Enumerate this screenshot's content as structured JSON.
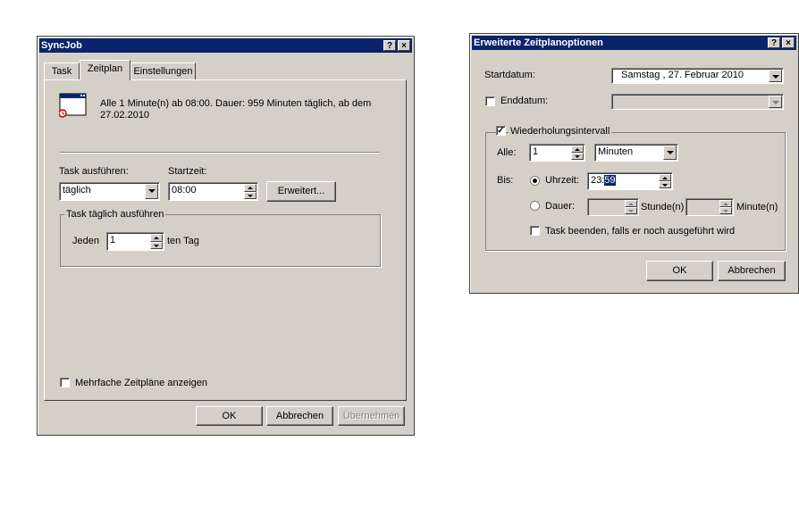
{
  "syncjob": {
    "title": "SyncJob",
    "help_label": "?",
    "close_label": "×",
    "tabs": [
      "Task",
      "Zeitplan",
      "Einstellungen"
    ],
    "summary_line1": "Alle 1 Minute(n) ab 08:00. Dauer: 959 Minuten täglich, ab dem",
    "summary_line2": "27.02.2010",
    "task_ausfuehren_label": "Task ausführen:",
    "task_ausfuehren_value": "täglich",
    "startzeit_label": "Startzeit:",
    "startzeit_value": "08:00",
    "erweitert_button": "Erweitert...",
    "group_title": "Task täglich ausführen",
    "jeden_label": "Jeden",
    "jeden_value": "1",
    "ten_tag_label": "ten Tag",
    "mehrfache_label": "Mehrfache Zeitpläne anzeigen",
    "ok_button": "OK",
    "abbrechen_button": "Abbrechen",
    "uebernehmen_button": "Übernehmen"
  },
  "erweitert": {
    "title": "Erweiterte Zeitplanoptionen",
    "help_label": "?",
    "close_label": "×",
    "startdatum_label": "Startdatum:",
    "startdatum_value": "Samstag , 27.  Februar  2010",
    "enddatum_label": "Enddatum:",
    "wiederholung_label": "Wiederholungsintervall",
    "check_mark": "✓",
    "alle_label": "Alle:",
    "alle_value": "1",
    "einheit_value": "Minuten",
    "bis_label": "Bis:",
    "uhrzeit_label": "Uhrzeit:",
    "uhrzeit_hour": "23:",
    "uhrzeit_minute": "59",
    "dauer_label": "Dauer:",
    "stunden_label": "Stunde(n)",
    "minuten_label": "Minute(n)",
    "task_beenden_label": "Task beenden, falls er noch ausgeführt wird",
    "ok_button": "OK",
    "abbrechen_button": "Abbrechen"
  }
}
